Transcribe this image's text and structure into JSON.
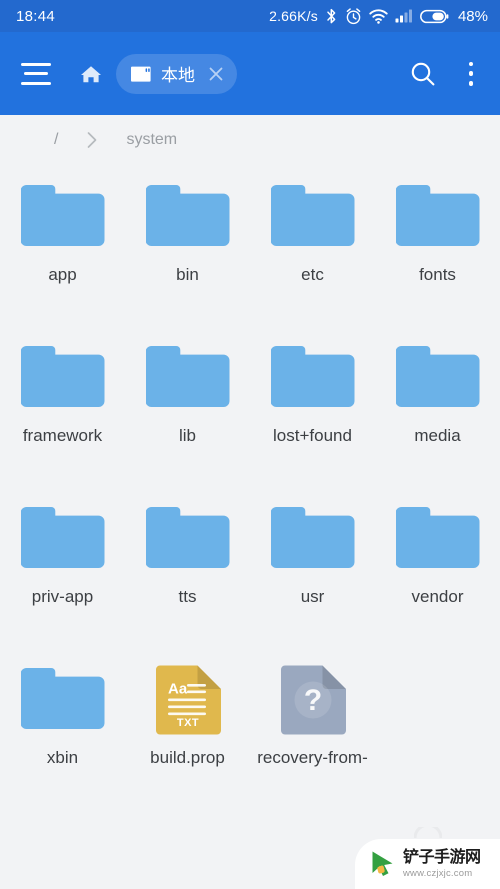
{
  "status_bar": {
    "clock": "18:44",
    "network_speed": "2.66K/s",
    "battery_percent": "48%",
    "icons": [
      "bluetooth-icon",
      "alarm-icon",
      "wifi-icon",
      "cellular-signal-icon",
      "battery-icon"
    ],
    "background_color": "#2369ce"
  },
  "toolbar": {
    "menu_label": "menu",
    "home_label": "home",
    "tab": {
      "label": "本地",
      "icon": "sdcard-icon",
      "close_label": "close"
    },
    "search_label": "search",
    "overflow_label": "more options",
    "background_color": "#2272de"
  },
  "breadcrumb": {
    "root": "/",
    "separator": "›",
    "current": "system"
  },
  "colors": {
    "folder": "#6bb2e8",
    "txt_file": "#e0b84d",
    "unknown_file": "#9aa8bf",
    "page_background": "#f2f3f5",
    "label_text": "#3c3f43"
  },
  "files": [
    {
      "name": "app",
      "type": "folder"
    },
    {
      "name": "bin",
      "type": "folder"
    },
    {
      "name": "etc",
      "type": "folder"
    },
    {
      "name": "fonts",
      "type": "folder"
    },
    {
      "name": "framework",
      "type": "folder"
    },
    {
      "name": "lib",
      "type": "folder"
    },
    {
      "name": "lost+found",
      "type": "folder"
    },
    {
      "name": "media",
      "type": "folder"
    },
    {
      "name": "priv-app",
      "type": "folder"
    },
    {
      "name": "tts",
      "type": "folder"
    },
    {
      "name": "usr",
      "type": "folder"
    },
    {
      "name": "vendor",
      "type": "folder"
    },
    {
      "name": "xbin",
      "type": "folder"
    },
    {
      "name": "build.prop",
      "type": "txt",
      "badge": "TXT",
      "sample_text": "Aa"
    },
    {
      "name": "recovery-from-",
      "type": "unknown",
      "badge": "?"
    }
  ],
  "watermark": {
    "title": "铲子手游网",
    "url": "www.czjxjc.com",
    "logo": "cursor-arrow-icon"
  }
}
